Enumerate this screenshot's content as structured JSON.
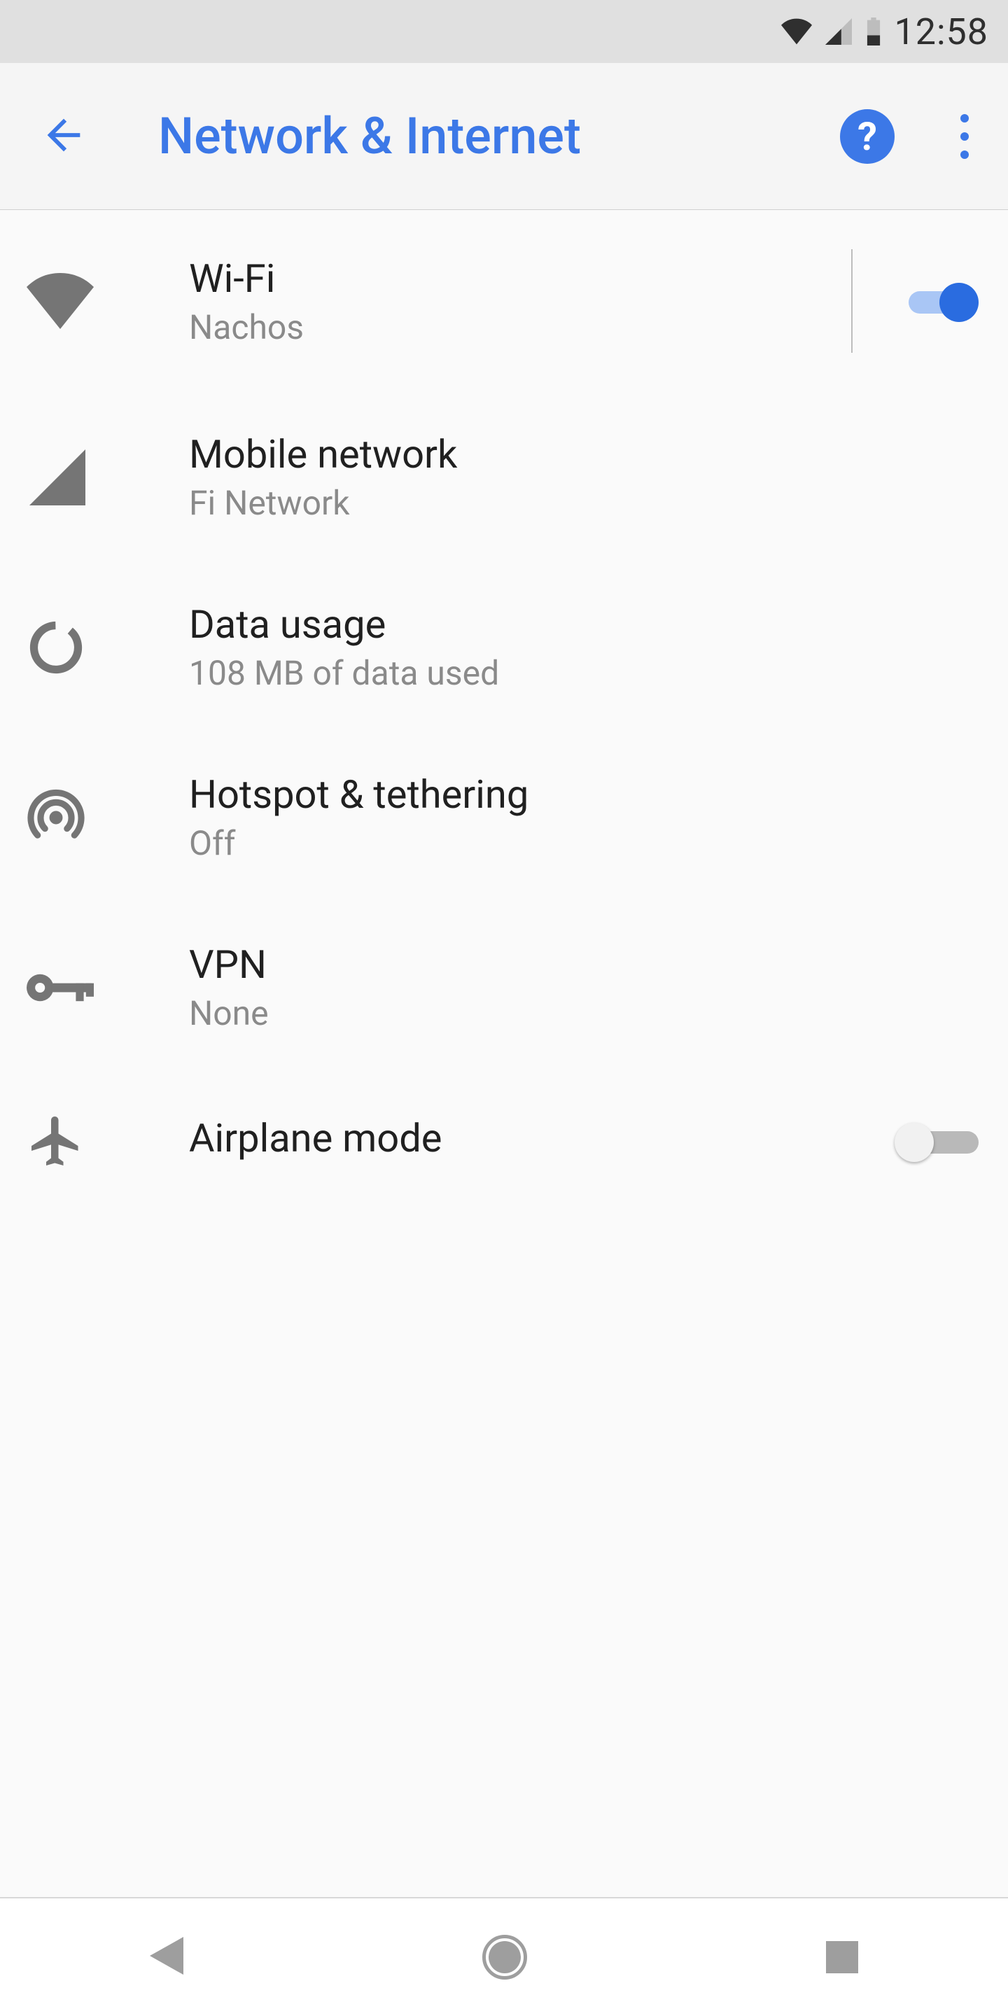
{
  "status": {
    "time": "12:58"
  },
  "appbar": {
    "title": "Network & Internet"
  },
  "rows": {
    "wifi": {
      "title": "Wi-Fi",
      "subtitle": "Nachos",
      "toggle_on": true
    },
    "mobile": {
      "title": "Mobile network",
      "subtitle": "Fi Network"
    },
    "data": {
      "title": "Data usage",
      "subtitle": "108 MB of data used"
    },
    "hotspot": {
      "title": "Hotspot & tethering",
      "subtitle": "Off"
    },
    "vpn": {
      "title": "VPN",
      "subtitle": "None"
    },
    "airplane": {
      "title": "Airplane mode",
      "toggle_on": false
    }
  },
  "colors": {
    "accent": "#3c78e7",
    "icon": "#757575"
  }
}
